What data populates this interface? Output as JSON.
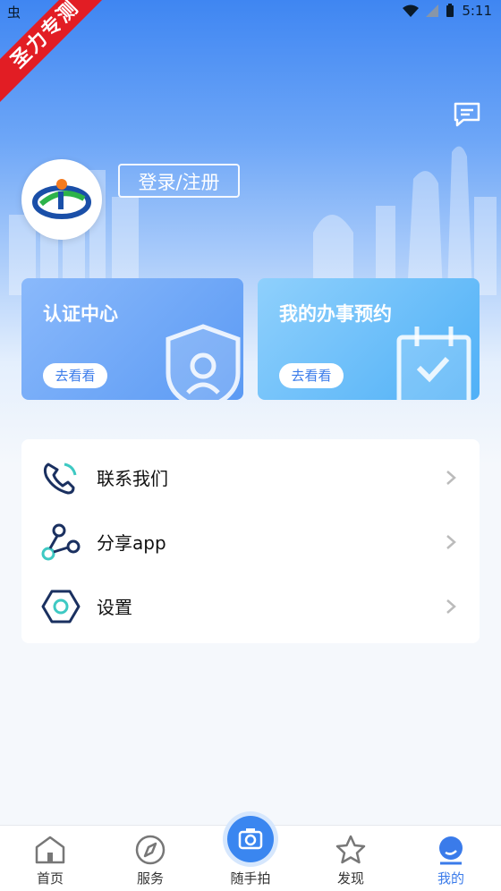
{
  "status_bar": {
    "left_icon": "app-notification-icon",
    "time": "5:11"
  },
  "ribbon": {
    "text": "圣力专测"
  },
  "header": {
    "login_label": "登录/注册",
    "message_icon": "message-icon"
  },
  "cards": [
    {
      "title": "认证中心",
      "button": "去看看",
      "icon": "shield-icon"
    },
    {
      "title": "我的办事预约",
      "button": "去看看",
      "icon": "calendar-icon"
    }
  ],
  "menu": [
    {
      "label": "联系我们",
      "icon": "phone-icon"
    },
    {
      "label": "分享app",
      "icon": "share-icon"
    },
    {
      "label": "设置",
      "icon": "settings-icon"
    }
  ],
  "tabs": [
    {
      "label": "首页",
      "icon": "home-icon"
    },
    {
      "label": "服务",
      "icon": "compass-icon"
    },
    {
      "label": "随手拍",
      "icon": "camera-icon"
    },
    {
      "label": "发现",
      "icon": "star-icon"
    },
    {
      "label": "我的",
      "icon": "profile-icon",
      "active": true
    }
  ],
  "colors": {
    "primary": "#3a7bea",
    "ribbon": "#e21d24"
  }
}
